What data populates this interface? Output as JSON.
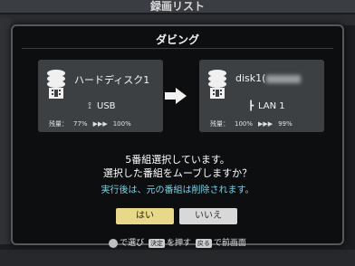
{
  "background": {
    "title": "録画リスト"
  },
  "dialog": {
    "title": "ダビング",
    "source": {
      "name": "ハードディスク1",
      "connection": "USB",
      "remain_label": "残量：",
      "remain_from": "77%",
      "remain_to": "100%",
      "arrows": "▶▶▶",
      "icon": "hdd-icon"
    },
    "destination": {
      "name": "disk1(",
      "connection": "LAN 1",
      "remain_label": "残量：",
      "remain_from": "100%",
      "remain_to": "99%",
      "arrows": "▶▶▶",
      "icon": "hdd-icon"
    },
    "message_line1": "5番組選択しています。",
    "message_line2": "選択した番組をムーブしますか？",
    "message_line3": "実行後は、元の番組は削除されます。",
    "yes_label": "はい",
    "no_label": "いいえ"
  },
  "hints": {
    "select": "で選び",
    "confirm_key": "決定",
    "confirm": "を押す",
    "back_key": "戻る",
    "back": "で前画面"
  }
}
